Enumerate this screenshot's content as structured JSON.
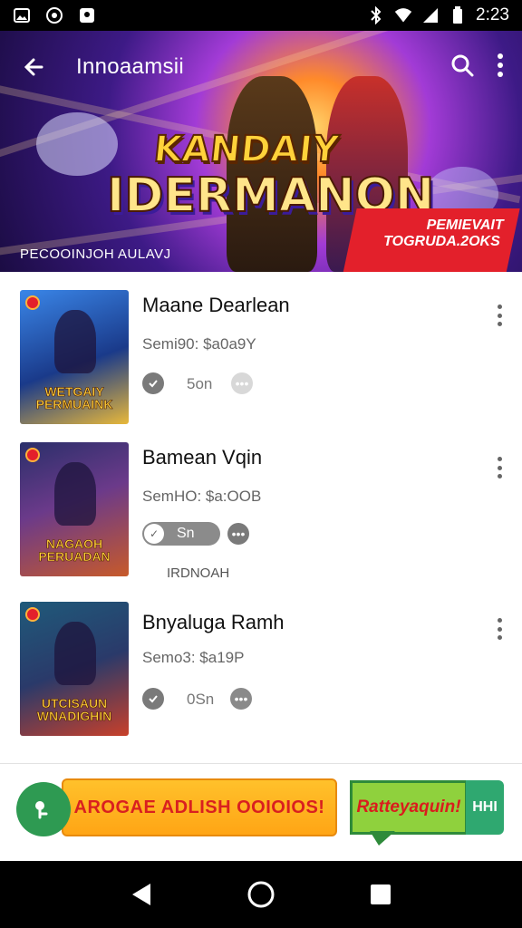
{
  "status_bar": {
    "time": "2:23",
    "icons": [
      "image-icon",
      "whatsapp-icon",
      "notification-icon",
      "bluetooth-icon",
      "wifi-icon",
      "signal-icon",
      "battery-icon"
    ]
  },
  "header": {
    "title": "Innoaamsii",
    "back_icon": "back-arrow-icon",
    "search_icon": "search-icon",
    "menu_icon": "more-vert-icon"
  },
  "hero": {
    "logo_line1": "KANDAIY",
    "logo_line2": "IDERMANON",
    "caption": "PECOOINJOH AULAVJ",
    "badge_line1": "PEMIEVAIT",
    "badge_line2": "TOGRUDA.2OKS"
  },
  "items": [
    {
      "title": "Maane Dearlean",
      "price": "Semi90: $a0a9Y",
      "thumb_text_1": "WETGAIY",
      "thumb_text_2": "PERMUAINK",
      "meta": "5on",
      "colors": {
        "bg1": "#2a6bd6",
        "bg2": "#f7d45a"
      }
    },
    {
      "title": "Bamean Vqin",
      "price": "SemHO: $a:OOB",
      "thumb_text_1": "NAGAOH",
      "thumb_text_2": "PERUADAN",
      "pill_label": "Sn",
      "status": "IRDNOAH",
      "colors": {
        "bg1": "#1e2a6e",
        "bg2": "#c7552a"
      }
    },
    {
      "title": "Bnyaluga Ramh",
      "price": "Semo3: $a19P",
      "thumb_text_1": "UTCISAUN",
      "thumb_text_2": "WNADIGHIN",
      "meta": "0Sn",
      "colors": {
        "bg1": "#204a6a",
        "bg2": "#d23a2a"
      }
    }
  ],
  "ad": {
    "main_label": "AROGAE ADLISH OOIOIOS!",
    "bubble_label": "Ratteyaquin!",
    "side_label": "HHI",
    "colors": {
      "orange": "#ffb020",
      "green": "#2e9a52"
    }
  },
  "nav": {
    "icons": [
      "back-triangle-icon",
      "home-circle-icon",
      "recents-square-icon"
    ]
  }
}
